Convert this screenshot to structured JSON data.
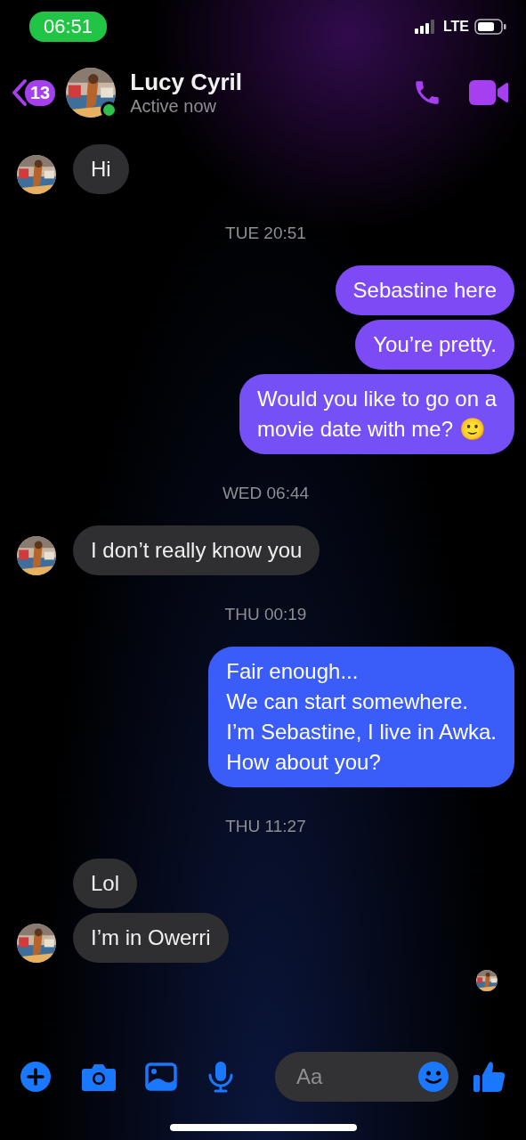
{
  "status_bar": {
    "time": "06:51",
    "network": "LTE"
  },
  "header": {
    "back_badge": "13",
    "contact_name": "Lucy Cyril",
    "presence": "Active now",
    "online": true
  },
  "messages": [
    {
      "kind": "incoming",
      "text": "Hi",
      "avatar": true
    },
    {
      "kind": "timestamp",
      "text": "TUE 20:51"
    },
    {
      "kind": "outgoing",
      "text": "Sebastine here",
      "color": "#7d4af6"
    },
    {
      "kind": "outgoing",
      "text": "You’re pretty.",
      "color": "#7c4bf6"
    },
    {
      "kind": "outgoing",
      "text": "Would you like to go on a\nmovie date with me?  🙂",
      "color": "#7450f6"
    },
    {
      "kind": "timestamp",
      "text": "WED 06:44"
    },
    {
      "kind": "incoming",
      "text": "I don’t really know you",
      "avatar": true
    },
    {
      "kind": "timestamp",
      "text": "THU 00:19"
    },
    {
      "kind": "outgoing",
      "text": "Fair enough...\nWe can start somewhere.\nI’m Sebastine, I live in Awka.\nHow about you?",
      "color": "#3a5cf8"
    },
    {
      "kind": "timestamp",
      "text": "THU 11:27"
    },
    {
      "kind": "incoming",
      "text": "Lol",
      "avatar": false
    },
    {
      "kind": "incoming",
      "text": "I’m in Owerri",
      "avatar": true
    },
    {
      "kind": "seen"
    }
  ],
  "composer": {
    "placeholder": "Aa"
  }
}
